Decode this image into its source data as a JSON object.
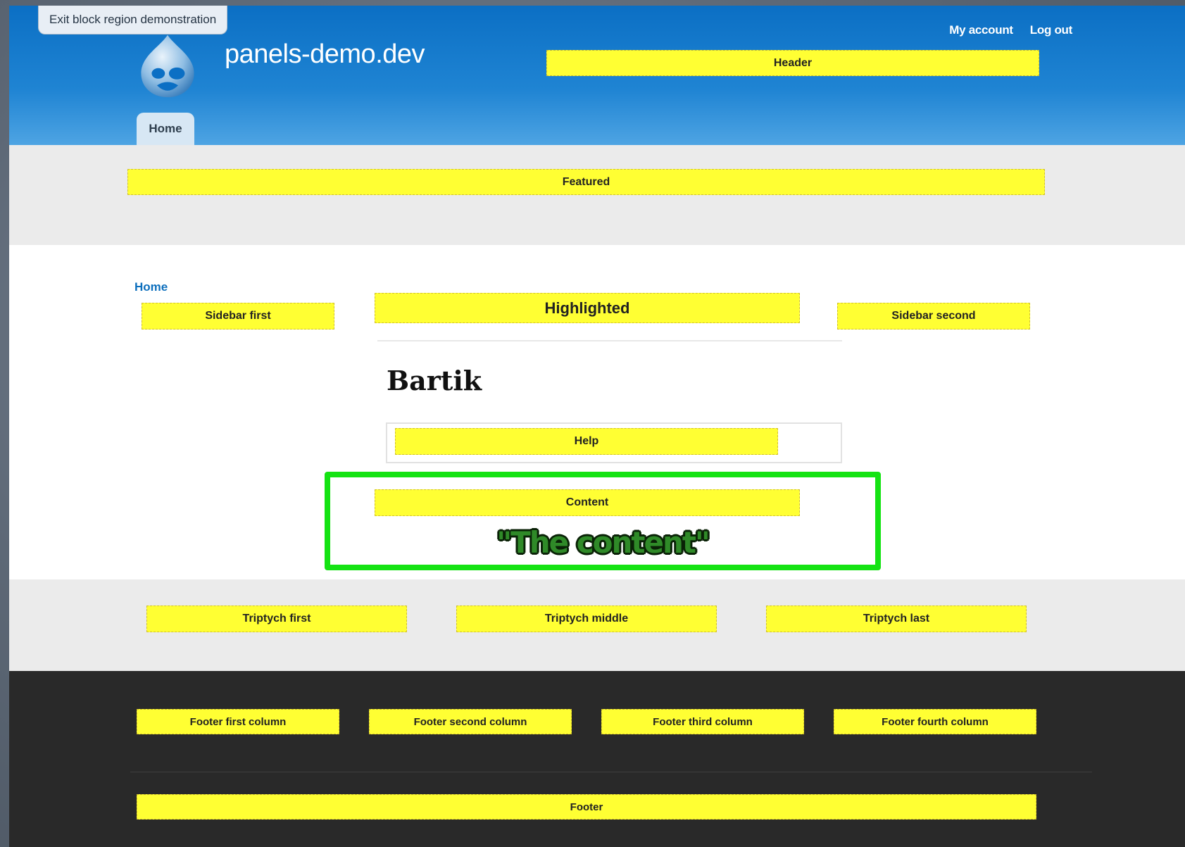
{
  "exit_demo_label": "Exit block region demonstration",
  "site": {
    "name": "panels-demo.dev",
    "logo_icon": "drupal-drop-icon"
  },
  "secondary_menu": {
    "my_account": "My account",
    "log_out": "Log out"
  },
  "main_menu": {
    "home": "Home"
  },
  "breadcrumb": {
    "home": "Home"
  },
  "page_title": "Bartik",
  "content_caption": "\"The content\"",
  "regions": {
    "header": "Header",
    "featured": "Featured",
    "sidebar_first": "Sidebar first",
    "highlighted": "Highlighted",
    "sidebar_second": "Sidebar second",
    "help": "Help",
    "content": "Content",
    "triptych_first": "Triptych first",
    "triptych_middle": "Triptych middle",
    "triptych_last": "Triptych last",
    "footer_first": "Footer first column",
    "footer_second": "Footer second column",
    "footer_third": "Footer third column",
    "footer_fourth": "Footer fourth column",
    "footer": "Footer"
  },
  "colors": {
    "region_highlight": "#ffff33",
    "header_blue": "#1f84d3",
    "content_outline": "#15e313",
    "footer_dark": "#292929"
  }
}
